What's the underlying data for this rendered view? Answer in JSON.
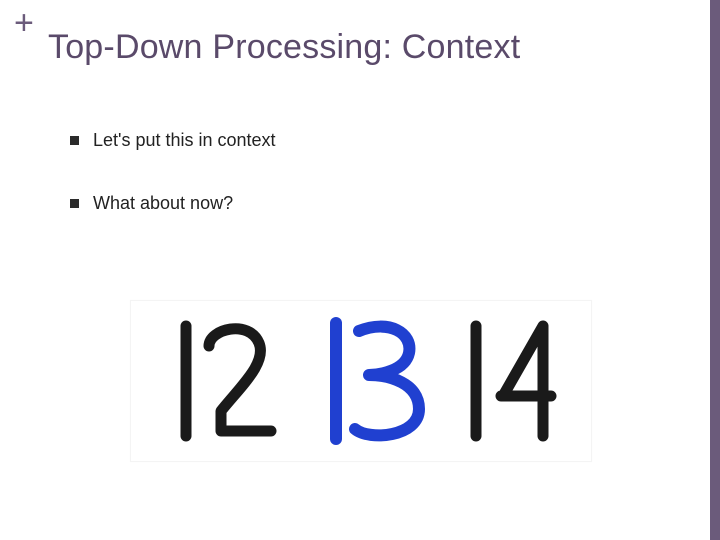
{
  "accent_color": "#6b5b7b",
  "plus_glyph": "+",
  "title": "Top-Down Processing: Context",
  "bullets": [
    {
      "label": "Let's put this in context"
    },
    {
      "label": "What about now?"
    }
  ],
  "figure": {
    "description": "handwritten-12-13-14",
    "numbers": [
      "12",
      "13",
      "14"
    ],
    "highlight_index": 1,
    "stroke_black": "#1a1a1a",
    "stroke_blue": "#2040d0"
  }
}
